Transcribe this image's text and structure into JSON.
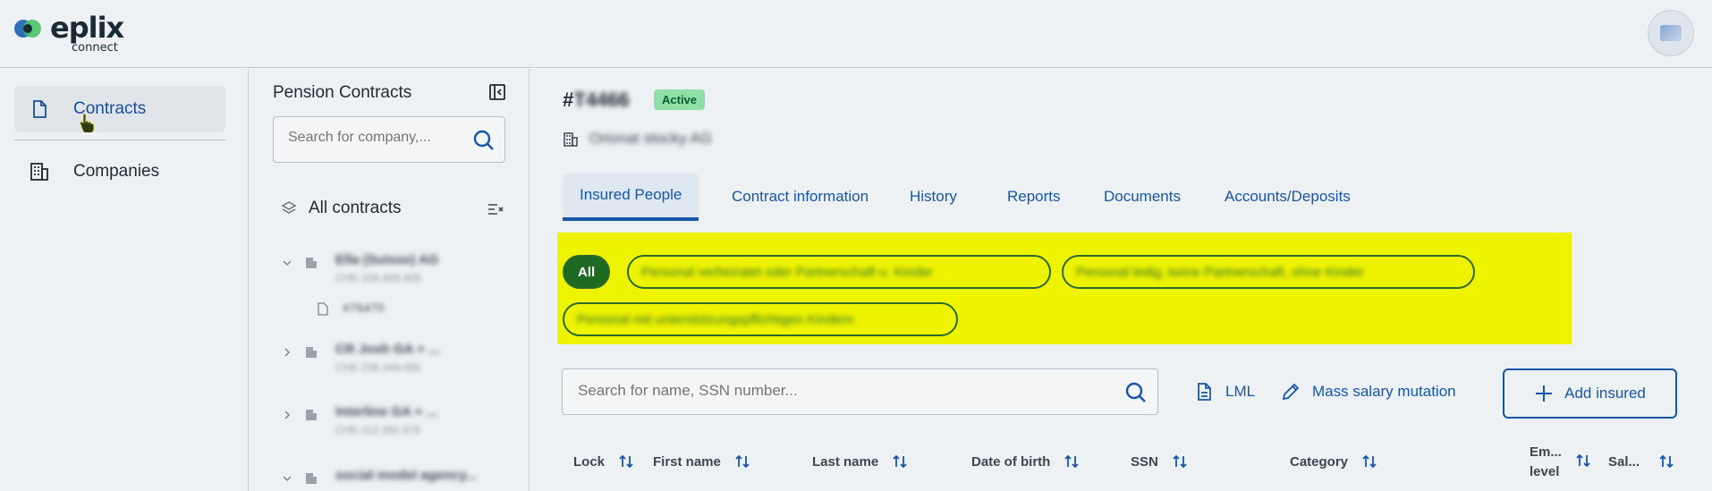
{
  "brand": {
    "name": "eplix",
    "sub": "connect"
  },
  "nav": {
    "items": [
      {
        "label": "Contracts",
        "active": true
      },
      {
        "label": "Companies",
        "active": false
      }
    ]
  },
  "panel": {
    "title": "Pension Contracts",
    "search_placeholder": "Search for company,...",
    "all_label": "All contracts",
    "tree": [
      {
        "name": "Ella (Suisse) AG",
        "sub": "CHE-106.669.905",
        "expanded": true
      },
      {
        "name": "#76470",
        "is_contract": true
      },
      {
        "name": "CR Josh GA + ...",
        "sub": "CHE-236.349.085",
        "expanded": false
      },
      {
        "name": "Interline GA + ...",
        "sub": "CHE-112.360.976",
        "expanded": false
      },
      {
        "name": "social model agency...",
        "sub": "",
        "expanded": true
      }
    ]
  },
  "contract": {
    "hash": "#",
    "id": "T4466",
    "status": "Active",
    "company": "Orionat stocky AG"
  },
  "tabs": [
    {
      "label": "Insured People",
      "active": true
    },
    {
      "label": "Contract information",
      "active": false
    },
    {
      "label": "History",
      "active": false
    },
    {
      "label": "Reports",
      "active": false
    },
    {
      "label": "Documents",
      "active": false
    },
    {
      "label": "Accounts/Deposits",
      "active": false
    }
  ],
  "filters": [
    {
      "label": "All",
      "selected": true
    },
    {
      "label": "Personal verheiratet oder Partnerschaft u. Kinder",
      "selected": false
    },
    {
      "label": "Personal ledig, keine Partnerschaft, ohne Kinder",
      "selected": false
    },
    {
      "label": "Personal mit unterstützungspflichtigen Kindern",
      "selected": false
    }
  ],
  "search": {
    "placeholder": "Search for name, SSN number..."
  },
  "actions": {
    "lml": "LML",
    "mass_salary": "Mass salary mutation",
    "add_insured": "Add insured"
  },
  "table": {
    "columns": [
      "Lock",
      "First name",
      "Last name",
      "Date of birth",
      "SSN",
      "Category",
      "Em...\nlevel",
      "Sal..."
    ],
    "col_em_line1": "Em...",
    "col_em_line2": "level"
  },
  "colors": {
    "accent": "#1656a8",
    "active_badge": "#8fe0a6",
    "highlight": "#eef400",
    "chip_green": "#1f6a23"
  }
}
